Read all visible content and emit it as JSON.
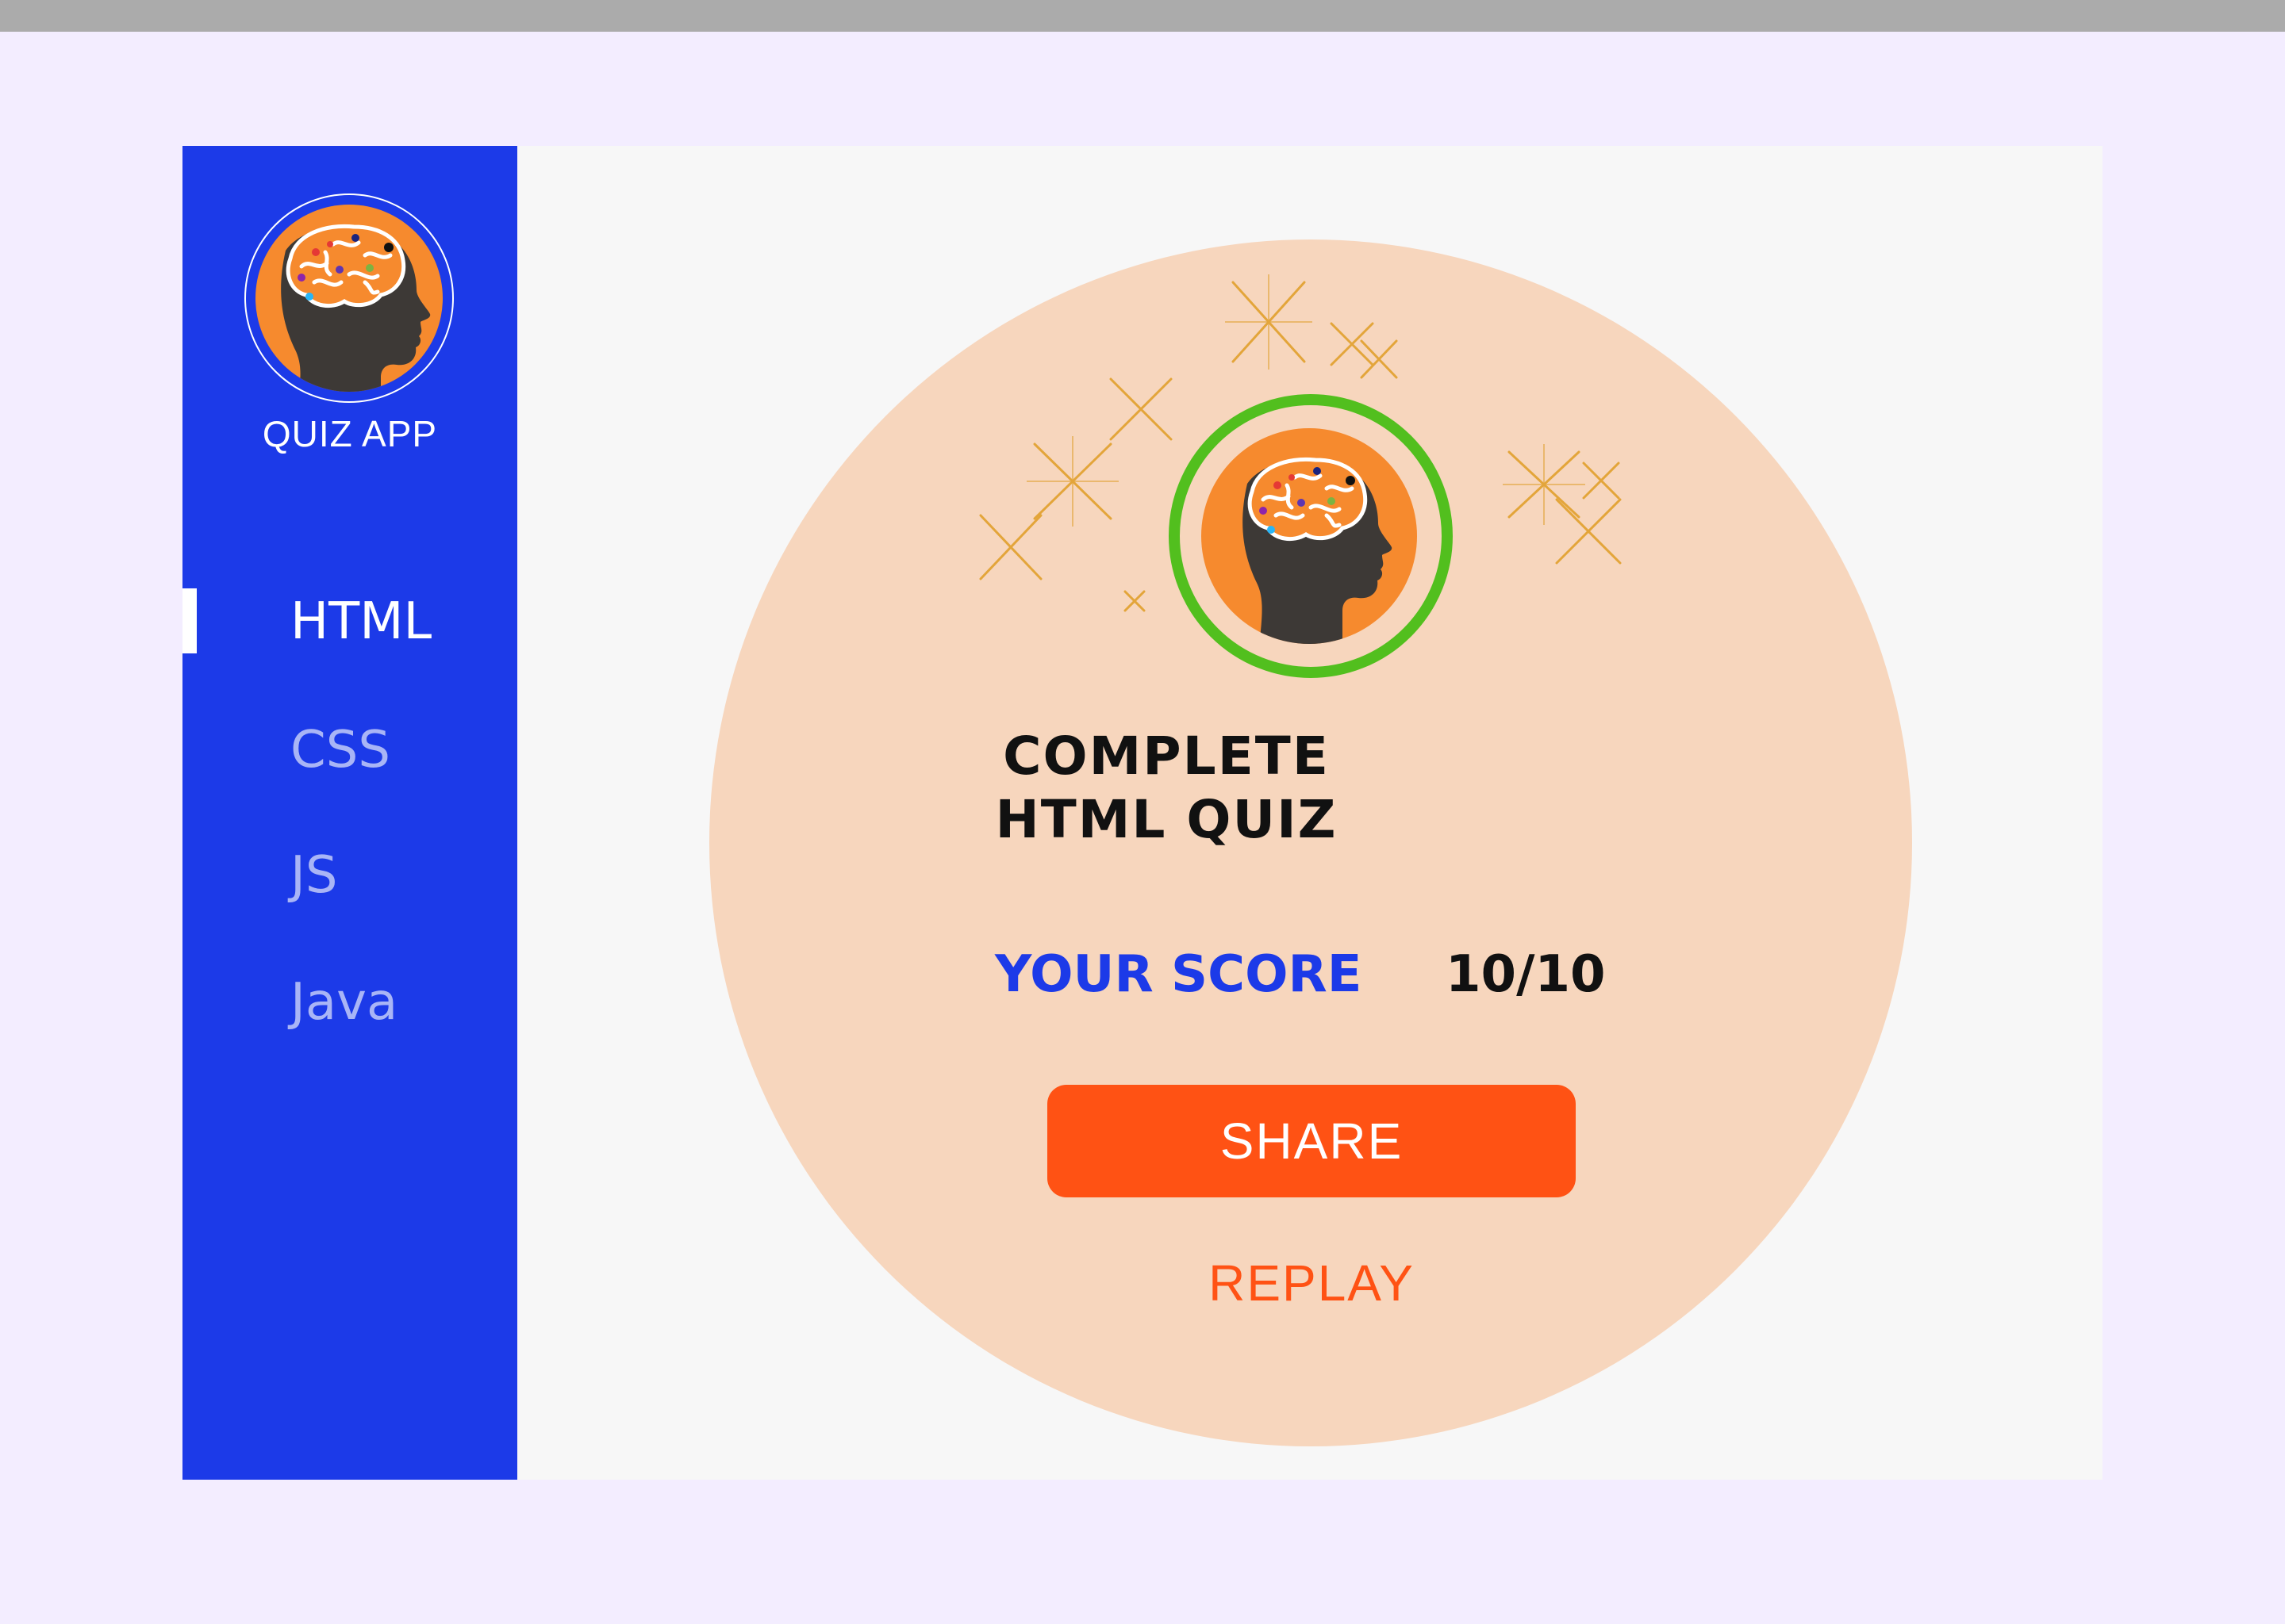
{
  "sidebar": {
    "app_name": "QUIZ APP",
    "logo_icon": "brain-head-icon",
    "items": [
      {
        "label": "HTML",
        "active": true
      },
      {
        "label": "CSS",
        "active": false
      },
      {
        "label": "JS",
        "active": false
      },
      {
        "label": "Java",
        "active": false
      }
    ]
  },
  "result": {
    "badge_icon": "brain-head-icon",
    "title_line1": "COMPLETE",
    "title_line2": "HTML QUIZ",
    "score_label": "YOUR SCORE",
    "score_value": "10/10",
    "share_label": "SHARE",
    "replay_label": "REPLAY"
  },
  "colors": {
    "sidebar_bg": "#1c3ae8",
    "accent_orange": "#ff5214",
    "card_bg": "#f7d6bd",
    "badge_ring": "#52bf1e",
    "page_bg": "#f3edff"
  }
}
